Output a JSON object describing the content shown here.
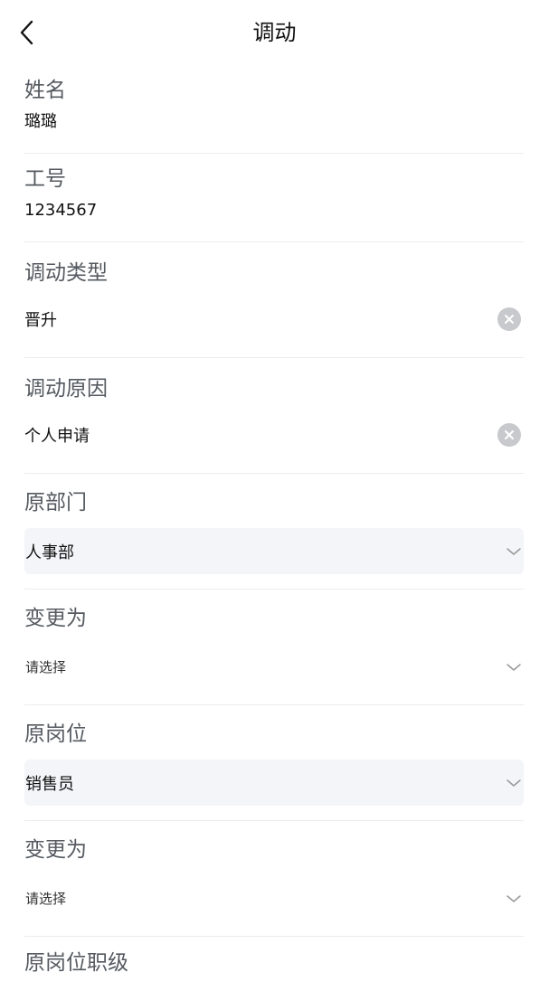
{
  "header": {
    "title": "调动"
  },
  "fields": {
    "name": {
      "label": "姓名",
      "value": "璐璐"
    },
    "employee_id": {
      "label": "工号",
      "value": "1234567"
    },
    "transfer_type": {
      "label": "调动类型",
      "value": "晋升"
    },
    "transfer_reason": {
      "label": "调动原因",
      "value": "个人申请"
    },
    "original_department": {
      "label": "原部门",
      "value": "人事部"
    },
    "new_department": {
      "label": "变更为",
      "placeholder": "请选择"
    },
    "original_position": {
      "label": "原岗位",
      "value": "销售员"
    },
    "new_position": {
      "label": "变更为",
      "placeholder": "请选择"
    },
    "original_position_level": {
      "label": "原岗位职级"
    }
  },
  "icons": {
    "back": "chevron-left-icon",
    "clear": "clear-circle-icon",
    "dropdown": "chevron-down-icon"
  },
  "colors": {
    "label": "#555a60",
    "value": "#111111",
    "filled_select_bg": "#f4f5f8",
    "clear_icon_bg": "#c8c9cc",
    "divider": "#ececec"
  }
}
